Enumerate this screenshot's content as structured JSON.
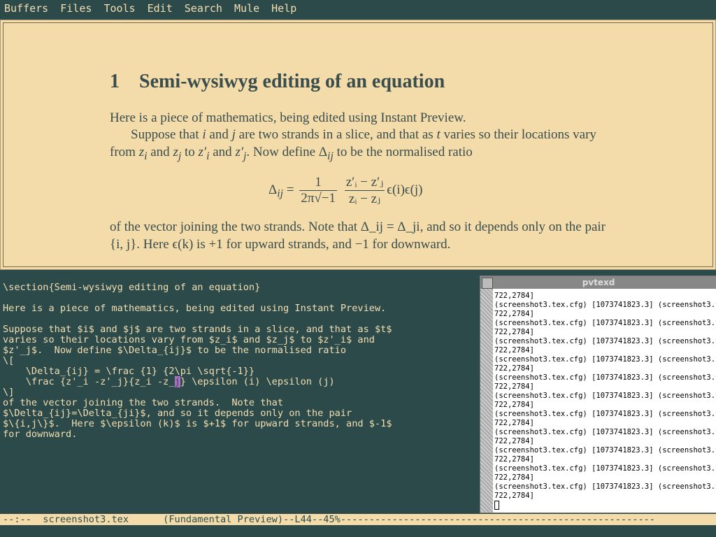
{
  "menubar": [
    "Buffers",
    "Files",
    "Tools",
    "Edit",
    "Search",
    "Mule",
    "Help"
  ],
  "preview": {
    "section_number": "1",
    "section_title": "Semi-wysiwyg editing of an equation",
    "intro": "Here is a piece of mathematics, being edited using Instant Preview.",
    "para1_a": "Suppose that ",
    "para1_b": " and ",
    "para1_c": " are two strands in a slice, and that as ",
    "para1_d": " varies so their locations vary from ",
    "para1_e": " and ",
    "para1_f": " to ",
    "para1_g": " and ",
    "para1_h": ". Now define Δ",
    "para1_i": " to be the normalised ratio",
    "eq_lhs": "Δ",
    "eq_one": "1",
    "eq_den1": "2π√−1",
    "eq_num2": "z′ᵢ − z′ⱼ",
    "eq_den2": "zᵢ − zⱼ",
    "eq_tail": "ϵ(i)ϵ(j)",
    "para2": "of the vector joining the two strands. Note that Δ_ij = Δ_ji, and so it depends only on the pair {i, j}. Here ϵ(k) is +1 for upward strands, and −1 for downward."
  },
  "editor": {
    "lines": [
      "\\section{Semi-wysiwyg editing of an equation}",
      "",
      "Here is a piece of mathematics, being edited using Instant Preview.",
      "",
      "Suppose that $i$ and $j$ are two strands in a slice, and that as $t$",
      "varies so their locations vary from $z_i$ and $z_j$ to $z'_i$ and",
      "$z'_j$.  Now define $\\Delta_{ij}$ to be the normalised ratio",
      "\\[",
      "    \\Delta_{ij} = \\frac {1} {2\\pi \\sqrt{-1}}",
      "    \\frac {z'_i -z'_j}{z_i -z_",
      "\\]",
      "of the vector joining the two strands.  Note that",
      "$\\Delta_{ij}=\\Delta_{ji}$, and so it depends only on the pair",
      "$\\{i,j\\}$.  Here $\\epsilon (k)$ is $+1$ for upward strands, and $-1$",
      "for downward."
    ],
    "cursor_char": "j",
    "after_cursor": "} \\epsilon (i) \\epsilon (j)"
  },
  "pvtexd": {
    "title": "pvtexd",
    "log_a": "722,2784]",
    "log_b": "(screenshot3.tex.cfg) [1073741823.3] (screenshot3.tex"
  },
  "modeline": "--:--  screenshot3.tex      (Fundamental Preview)--L44--45%-------------------------------------------------------"
}
